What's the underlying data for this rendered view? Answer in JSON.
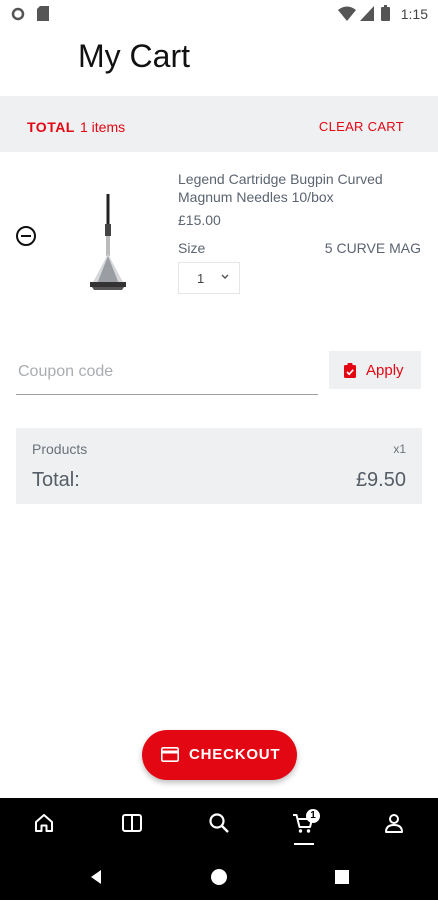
{
  "status_bar": {
    "time": "1:15"
  },
  "header": {
    "title": "My Cart"
  },
  "summary_strip": {
    "total_label": "TOTAL",
    "items_count": "1 items",
    "clear_cart": "CLEAR CART"
  },
  "cart_items": [
    {
      "name": "Legend Cartridge Bugpin Curved Magnum Needles 10/box",
      "price": "£15.00",
      "size_label": "Size",
      "size_value": "5 CURVE MAG",
      "quantity": "1"
    }
  ],
  "coupon": {
    "placeholder": "Coupon code",
    "value": "",
    "apply_label": "Apply"
  },
  "totals": {
    "products_label": "Products",
    "products_qty": "x1",
    "total_label": "Total:",
    "total_value": "£9.50"
  },
  "checkout": {
    "label": "CHECKOUT"
  },
  "bottom_nav": {
    "items": [
      {
        "icon": "home-icon"
      },
      {
        "icon": "catalog-icon"
      },
      {
        "icon": "search-icon"
      },
      {
        "icon": "cart-icon",
        "badge": "1"
      },
      {
        "icon": "account-icon"
      }
    ]
  },
  "colors": {
    "accent": "#e30613",
    "strip": "#eef0f2",
    "nav": "#000000"
  }
}
